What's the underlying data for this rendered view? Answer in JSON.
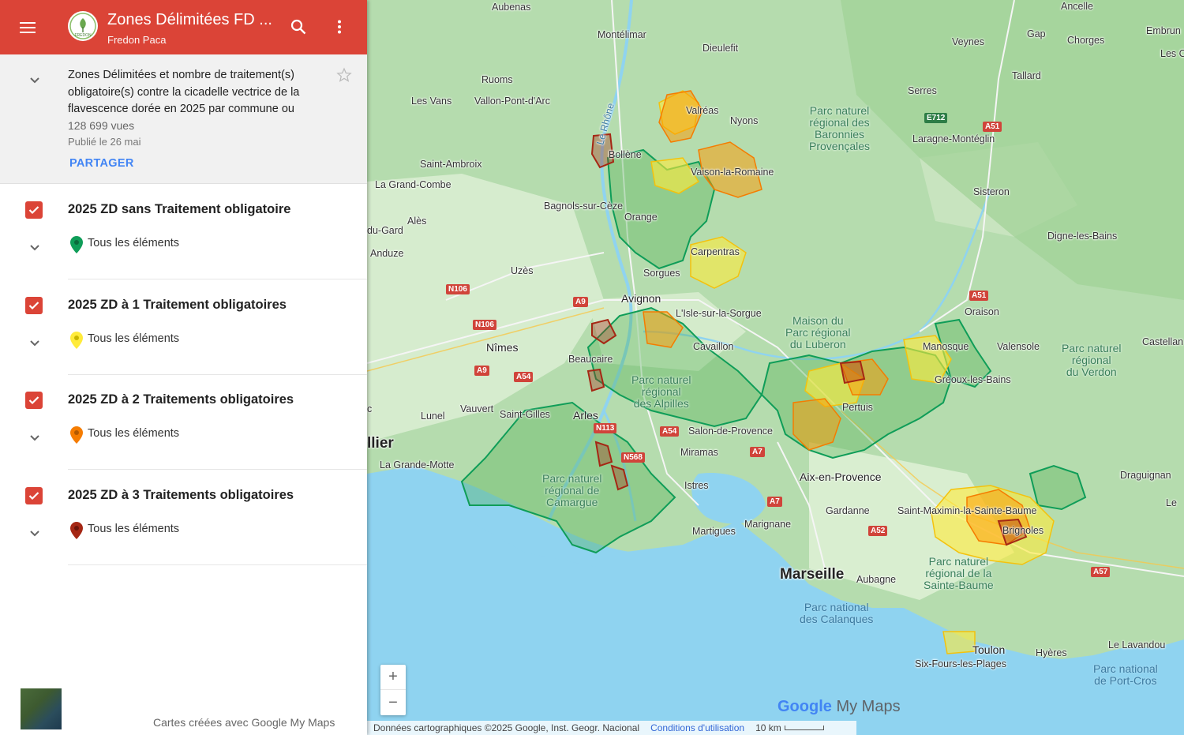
{
  "header": {
    "title": "Zones Délimitées FD ...",
    "subtitle": "Fredon Paca",
    "logo_text": "FREDON"
  },
  "description": {
    "text": "Zones Délimitées et nombre de traitement(s) obligatoire(s) contre la cicadelle vectrice de la flavescence dorée en 2025 par commune ou",
    "views": "128 699 vues",
    "published": "Publié le 26 mai",
    "share_label": "PARTAGER"
  },
  "layers": [
    {
      "title": "2025 ZD sans Traitement obligatoire",
      "item": "Tous les éléments",
      "pin_color": "#0f9d58"
    },
    {
      "title": "2025 ZD à 1 Traitement obligatoires",
      "item": "Tous les éléments",
      "pin_color": "#ffeb3b"
    },
    {
      "title": "2025 ZD à 2 Traitements obligatoires",
      "item": "Tous les éléments",
      "pin_color": "#f57c00"
    },
    {
      "title": "2025 ZD à 3 Traitements obligatoires",
      "item": "Tous les éléments",
      "pin_color": "#a52714"
    }
  ],
  "footer": {
    "credit": "Cartes créées avec Google My Maps"
  },
  "map": {
    "labels": {
      "aubenas": "Aubenas",
      "montelimar": "Montélimar",
      "dieulefit": "Dieulefit",
      "ruoms": "Ruoms",
      "lesvans": "Les Vans",
      "vallon": "Vallon-Pont-d'Arc",
      "lerhone": "Le Rhône",
      "valreas": "Valréas",
      "nyons": "Nyons",
      "bollene": "Bollène",
      "saintambroix": "Saint-Ambroix",
      "vaison": "Vaison-la-Romaine",
      "grandcombe": "La Grand-Combe",
      "bagnols": "Bagnols-sur-Cèze",
      "orange": "Orange",
      "ales": "Alès",
      "dugard": "du-Gard",
      "anduze": "Anduze",
      "carpentras": "Carpentras",
      "uzes": "Uzès",
      "sorgues": "Sorgues",
      "avignon": "Avignon",
      "lisle": "L'Isle-sur-la-Sorgue",
      "nimes": "Nîmes",
      "beaucaire": "Beaucaire",
      "cavaillon": "Cavaillon",
      "vauvert": "Vauvert",
      "lunel": "Lunel",
      "saintgilles": "Saint-Gilles",
      "arles": "Arles",
      "montpellier": "llier",
      "lagrandemotte": "La Grande-Motte",
      "salon": "Salon-de-Provence",
      "miramas": "Miramas",
      "istres": "Istres",
      "martigues": "Martigues",
      "marignane": "Marignane",
      "aix": "Aix-en-Provence",
      "pertuis": "Pertuis",
      "manosque": "Manosque",
      "valensole": "Valensole",
      "greoux": "Gréoux-les-Bains",
      "oraison": "Oraison",
      "sisteron": "Sisteron",
      "digne": "Digne-les-Bains",
      "ancelle": "Ancelle",
      "gap": "Gap",
      "chorges": "Chorges",
      "embrun": "Embrun",
      "lesc": "Les C",
      "veynes": "Veynes",
      "tallard": "Tallard",
      "serres": "Serres",
      "laragne": "Laragne-Montéglin",
      "castellane": "Castellan",
      "draguignan": "Draguignan",
      "le": "Le",
      "gardanne": "Gardanne",
      "saintmaximin": "Saint-Maximin-la-Sainte-Baume",
      "brignoles": "Brignoles",
      "marseille": "Marseille",
      "aubagne": "Aubagne",
      "toulon": "Toulon",
      "sixfours": "Six-Fours-les-Plages",
      "hyeres": "Hyères",
      "lelavandou": "Le Lavandou",
      "lec": "c"
    },
    "parks": {
      "baronnies": "Parc naturel\nrégional des\nBaronnies\nProvençales",
      "luberon": "Maison du\nParc régional\ndu Luberon",
      "verdon": "Parc naturel\nrégional\ndu Verdon",
      "alpilles": "Parc naturel\nrégional\ndes Alpilles",
      "camargue": "Parc naturel\nrégional de\nCamargue",
      "saintebaume": "Parc naturel\nrégional de la\nSainte-Baume",
      "calanques": "Parc national\ndes Calanques",
      "portcros": "Parc national\nde Port-Cros"
    },
    "shields": {
      "n106a": "N106",
      "n106b": "N106",
      "a9a": "A9",
      "a9b": "A9",
      "a54a": "A54",
      "a54b": "A54",
      "n113": "N113",
      "n568": "N568",
      "a7a": "A7",
      "a7b": "A7",
      "a51a": "A51",
      "a51b": "A51",
      "e712": "E712",
      "a52": "A52",
      "a57": "A57"
    },
    "zoom_in": "+",
    "zoom_out": "−",
    "logo_google": "Google",
    "logo_mymaps": "My Maps",
    "attribution": "Données cartographiques ©2025 Google, Inst. Geogr. Nacional",
    "terms": "Conditions d'utilisation",
    "scale": "10 km"
  }
}
